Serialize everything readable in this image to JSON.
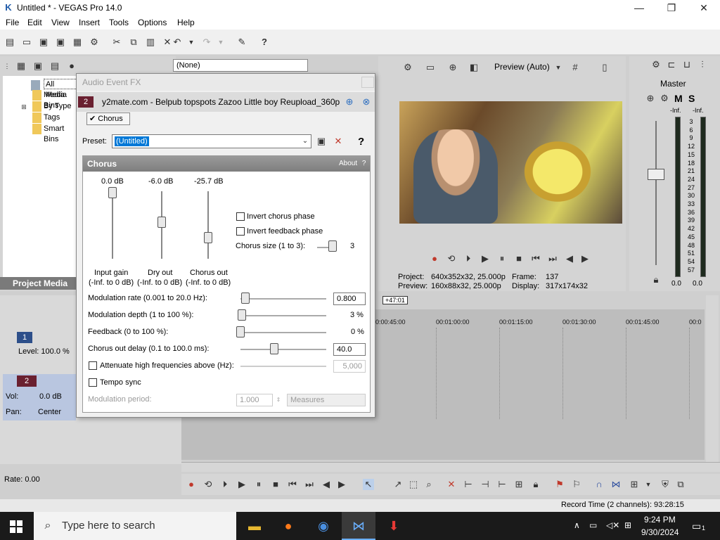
{
  "window": {
    "title": "Untitled * - VEGAS Pro 14.0",
    "min": "—",
    "max": "❐",
    "close": "✕"
  },
  "menu": [
    "File",
    "Edit",
    "View",
    "Insert",
    "Tools",
    "Options",
    "Help"
  ],
  "explorer": {
    "preset_value": "(None)",
    "items": [
      "All Media",
      "Media Bins",
      "By Type",
      "Tags",
      "Smart Bins"
    ],
    "tab": "Project Media"
  },
  "tracks": {
    "track1": {
      "num": "1",
      "level": "Level: 100.0 %"
    },
    "track2": {
      "num": "2",
      "vol_label": "Vol:",
      "vol_value": "0.0 dB",
      "pan_label": "Pan:",
      "pan_value": "Center"
    }
  },
  "dialog": {
    "title": "Audio Event FX",
    "track_num": "2",
    "clip_name": "y2mate.com - Belpub topspots Zazoo  Little boy Reupload_360p",
    "chain_item": "Chorus",
    "preset_label": "Preset:",
    "preset_value": "(Untitled)",
    "help": "?",
    "plugin_title": "Chorus",
    "about": "About",
    "about_q": "?",
    "input_gain": {
      "value": "0.0 dB",
      "label": "Input gain",
      "range": "(-Inf. to 0 dB)"
    },
    "dry_out": {
      "value": "-6.0 dB",
      "label": "Dry out",
      "range": "(-Inf. to 0 dB)"
    },
    "chorus_out": {
      "value": "-25.7 dB",
      "label": "Chorus out",
      "range": "(-Inf. to 0 dB)"
    },
    "invert_chorus": "Invert chorus phase",
    "invert_feedback": "Invert feedback phase",
    "chorus_size": {
      "label": "Chorus size (1 to 3):",
      "value": "3"
    },
    "mod_rate": {
      "label": "Modulation rate (0.001 to 20.0 Hz):",
      "value": "0.800"
    },
    "mod_depth": {
      "label": "Modulation depth (1 to 100 %):",
      "value": "3 %"
    },
    "feedback": {
      "label": "Feedback (0 to 100 %):",
      "value": "0 %"
    },
    "out_delay": {
      "label": "Chorus out delay (0.1 to 100.0 ms):",
      "value": "40.0"
    },
    "attenuate": {
      "label": "Attenuate high frequencies above (Hz):",
      "value": "5,000"
    },
    "tempo_sync": "Tempo sync",
    "mod_period": {
      "label": "Modulation period:",
      "value": "1.000",
      "unit": "Measures"
    }
  },
  "preview": {
    "mode": "Preview (Auto)",
    "project_label": "Project:",
    "project_value": "640x352x32, 25.000p",
    "preview_label": "Preview:",
    "preview_value": "160x88x32, 25.000p",
    "frame_label": "Frame:",
    "frame_value": "137",
    "display_label": "Display:",
    "display_value": "317x174x32"
  },
  "master": {
    "title": "Master",
    "m": "M",
    "s": "S",
    "inf_left": "-Inf.",
    "inf_right": "-Inf.",
    "scale": [
      "3",
      "6",
      "9",
      "12",
      "15",
      "18",
      "21",
      "24",
      "27",
      "30",
      "33",
      "36",
      "39",
      "42",
      "45",
      "48",
      "51",
      "54",
      "57"
    ],
    "val_left": "0.0",
    "val_right": "0.0"
  },
  "timeline": {
    "cursor_badge": "+47:01",
    "ticks": [
      "0:00:45:00",
      "00:01:00:00",
      "00:01:15:00",
      "00:01:30:00",
      "00:01:45:00",
      "00:0"
    ],
    "rate": "Rate: 0.00"
  },
  "status": {
    "record_time": "Record Time (2 channels): 93:28:15"
  },
  "taskbar": {
    "search_placeholder": "Type here to search",
    "time": "9:24 PM",
    "date": "9/30/2024",
    "notif": "1"
  }
}
